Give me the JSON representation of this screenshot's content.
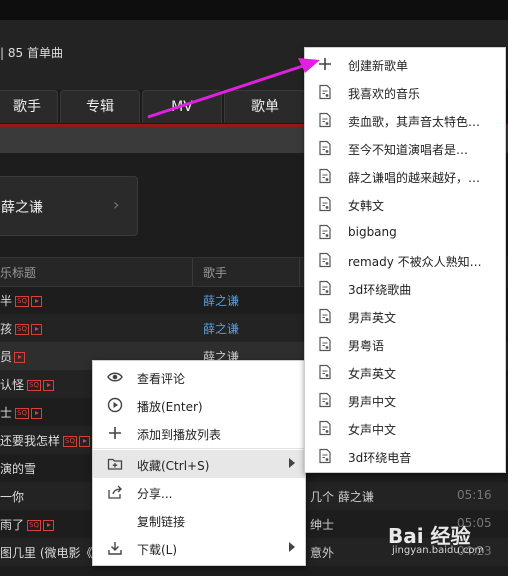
{
  "header": {
    "count_text": "| 85 首单曲"
  },
  "tabs": [
    {
      "label": "歌手"
    },
    {
      "label": "专辑"
    },
    {
      "label": "MV"
    },
    {
      "label": "歌单"
    }
  ],
  "artist_card": {
    "name": "薛之谦"
  },
  "table": {
    "columns": [
      "乐标题",
      "歌手"
    ],
    "rows": [
      {
        "title": "半",
        "artist": "薛之谦",
        "duration": ""
      },
      {
        "title": "孩",
        "artist": "薛之谦",
        "duration": ""
      },
      {
        "title": "员",
        "artist": "薛之谦",
        "duration": ""
      },
      {
        "title": "认怪",
        "artist": "",
        "duration": ""
      },
      {
        "title": "士",
        "artist": "",
        "duration": ""
      },
      {
        "title": "还要我怎样",
        "artist": "",
        "duration": ""
      },
      {
        "title": "演的雪",
        "artist": "",
        "duration": ""
      },
      {
        "title": "一你",
        "artist": "几个 薛之谦",
        "duration": "05:16"
      },
      {
        "title": "雨了",
        "artist": "绅士",
        "duration": "05:05"
      },
      {
        "title": "图几里 (微电影《",
        "artist": "意外",
        "duration": "04:23"
      }
    ]
  },
  "context_menu": [
    {
      "label": "查看评论",
      "icon": "eye-icon"
    },
    {
      "label": "播放(Enter)",
      "icon": "play-circle-icon"
    },
    {
      "label": "添加到播放列表",
      "icon": "plus-icon"
    },
    {
      "label": "收藏(Ctrl+S)",
      "icon": "folder-plus-icon",
      "submenu": true,
      "highlighted": true
    },
    {
      "label": "分享...",
      "icon": "share-icon"
    },
    {
      "label": "复制链接",
      "icon": ""
    },
    {
      "label": "下载(L)",
      "icon": "download-icon",
      "submenu": true
    }
  ],
  "submenu": [
    {
      "label": "创建新歌单",
      "icon": "plus-icon"
    },
    {
      "label": "我喜欢的音乐",
      "icon": "playlist-icon"
    },
    {
      "label": "卖血歌，其声音太特色…",
      "icon": "playlist-icon"
    },
    {
      "label": "至今不知道演唱者是…",
      "icon": "playlist-icon"
    },
    {
      "label": "薛之谦唱的越来越好，…",
      "icon": "playlist-icon"
    },
    {
      "label": "女韩文",
      "icon": "playlist-icon"
    },
    {
      "label": "bigbang",
      "icon": "playlist-icon"
    },
    {
      "label": "remady 不被众人熟知…",
      "icon": "playlist-icon"
    },
    {
      "label": "3d环绕歌曲",
      "icon": "playlist-icon"
    },
    {
      "label": "男声英文",
      "icon": "playlist-icon"
    },
    {
      "label": "男粤语",
      "icon": "playlist-icon"
    },
    {
      "label": "女声英文",
      "icon": "playlist-icon"
    },
    {
      "label": "男声中文",
      "icon": "playlist-icon"
    },
    {
      "label": "女声中文",
      "icon": "playlist-icon"
    },
    {
      "label": "3d环绕电音",
      "icon": "playlist-icon"
    }
  ],
  "badge": {
    "sq": "SQ"
  },
  "watermark": {
    "text": "Bai 经验",
    "sub": "jingyan.baidu.com"
  },
  "colors": {
    "accent_red": "#8e1b1b",
    "annotation_arrow": "#e020e0",
    "artist_link": "#5b9bd5"
  }
}
